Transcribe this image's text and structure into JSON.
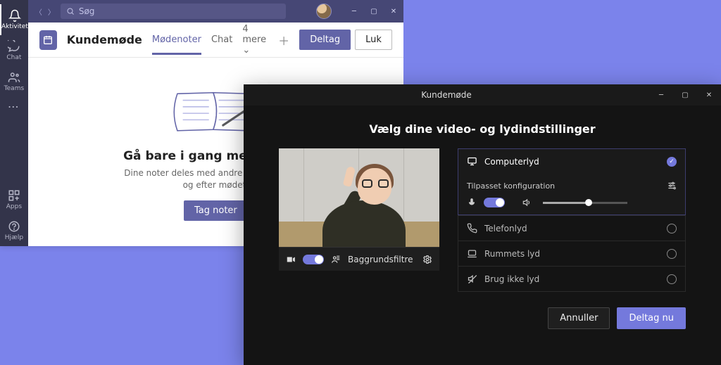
{
  "background": {
    "titlebar": {
      "search_placeholder": "Søg"
    },
    "sidebar": {
      "items": [
        {
          "label": "Aktivitet"
        },
        {
          "label": "Chat"
        },
        {
          "label": "Teams"
        },
        {
          "label": "Apps"
        },
        {
          "label": "Hjælp"
        }
      ]
    },
    "header": {
      "meeting_title": "Kundemøde",
      "tabs": [
        {
          "label": "Mødenoter",
          "active": true
        },
        {
          "label": "Chat"
        },
        {
          "label": "4 mere"
        }
      ],
      "join_label": "Deltag",
      "close_label": "Luk"
    },
    "body": {
      "title": "Gå bare i gang med at tage",
      "subtitle_line1": "Dine noter deles med andre og er tilgænge",
      "subtitle_line2": "og efter mødet.",
      "take_notes_label": "Tag noter"
    }
  },
  "join": {
    "window_title": "Kundemøde",
    "heading": "Vælg dine video- og lydindstillinger",
    "preview": {
      "bg_filters_label": "Baggrundsfiltre",
      "video_on": true
    },
    "audio": {
      "options": [
        {
          "id": "computer",
          "label": "Computerlyd",
          "selected": true
        },
        {
          "id": "phone",
          "label": "Telefonlyd",
          "selected": false
        },
        {
          "id": "room",
          "label": "Rummets lyd",
          "selected": false
        },
        {
          "id": "none",
          "label": "Brug ikke lyd",
          "selected": false
        }
      ],
      "config_label": "Tilpasset konfiguration",
      "mic_on": true,
      "volume_pct": 50
    },
    "footer": {
      "cancel_label": "Annuller",
      "join_label": "Deltag nu"
    }
  }
}
